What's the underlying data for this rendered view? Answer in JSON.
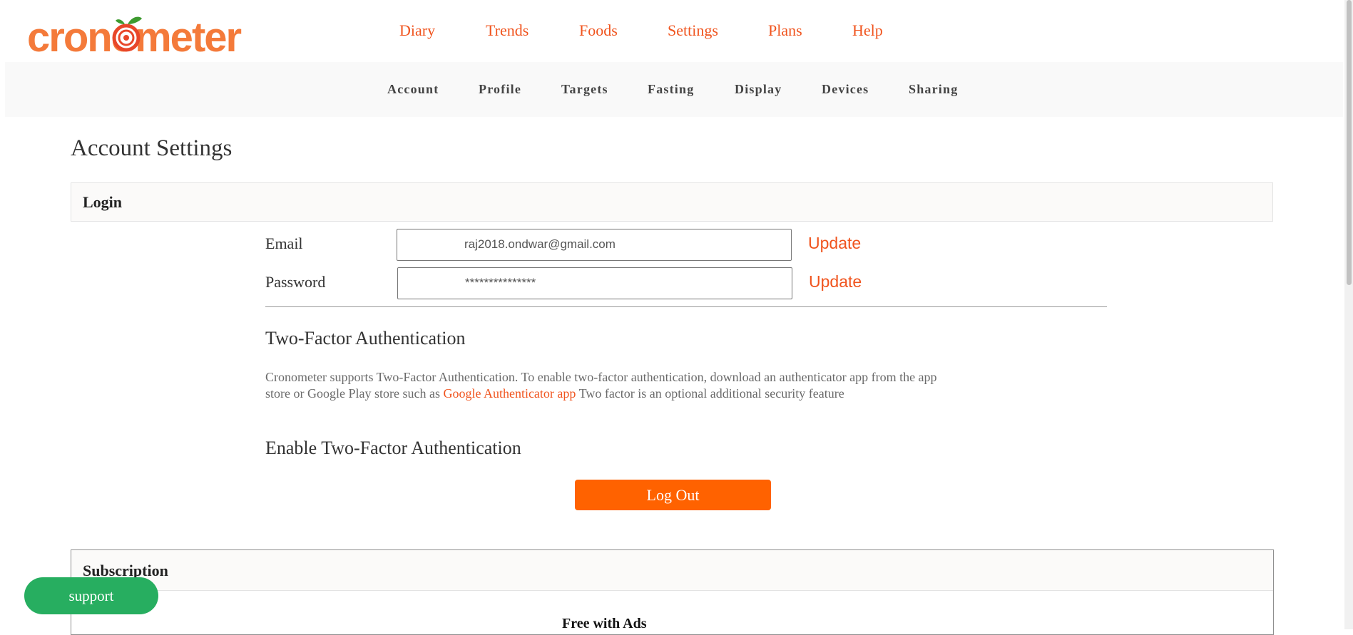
{
  "brand": {
    "logo_text": "cronometer",
    "colors": {
      "accent": "#f0541e",
      "button": "#ff6200",
      "support": "#27ae60",
      "leaf": "#3d9a2f"
    }
  },
  "top_nav": {
    "items": [
      {
        "label": "Diary"
      },
      {
        "label": "Trends"
      },
      {
        "label": "Foods"
      },
      {
        "label": "Settings"
      },
      {
        "label": "Plans"
      },
      {
        "label": "Help"
      }
    ]
  },
  "sub_nav": {
    "items": [
      {
        "label": "Account"
      },
      {
        "label": "Profile"
      },
      {
        "label": "Targets"
      },
      {
        "label": "Fasting"
      },
      {
        "label": "Display"
      },
      {
        "label": "Devices"
      },
      {
        "label": "Sharing"
      }
    ]
  },
  "page": {
    "title": "Account Settings"
  },
  "login": {
    "header": "Login",
    "email_label": "Email",
    "email_value": "raj2018.ondwar@gmail.com",
    "password_label": "Password",
    "password_value": "***************",
    "update_label": "Update"
  },
  "two_factor": {
    "title": "Two-Factor Authentication",
    "desc_before": "Cronometer supports Two-Factor Authentication. To enable two-factor authentication, download an authenticator app from the app store or Google Play store such as ",
    "link_text": "Google Authenticator app",
    "desc_after": " Two factor is an optional additional security feature",
    "enable_title": "Enable Two-Factor Authentication"
  },
  "logout": {
    "label": "Log Out"
  },
  "subscription": {
    "header": "Subscription",
    "plan": "Free with Ads"
  },
  "support": {
    "label": "support"
  }
}
